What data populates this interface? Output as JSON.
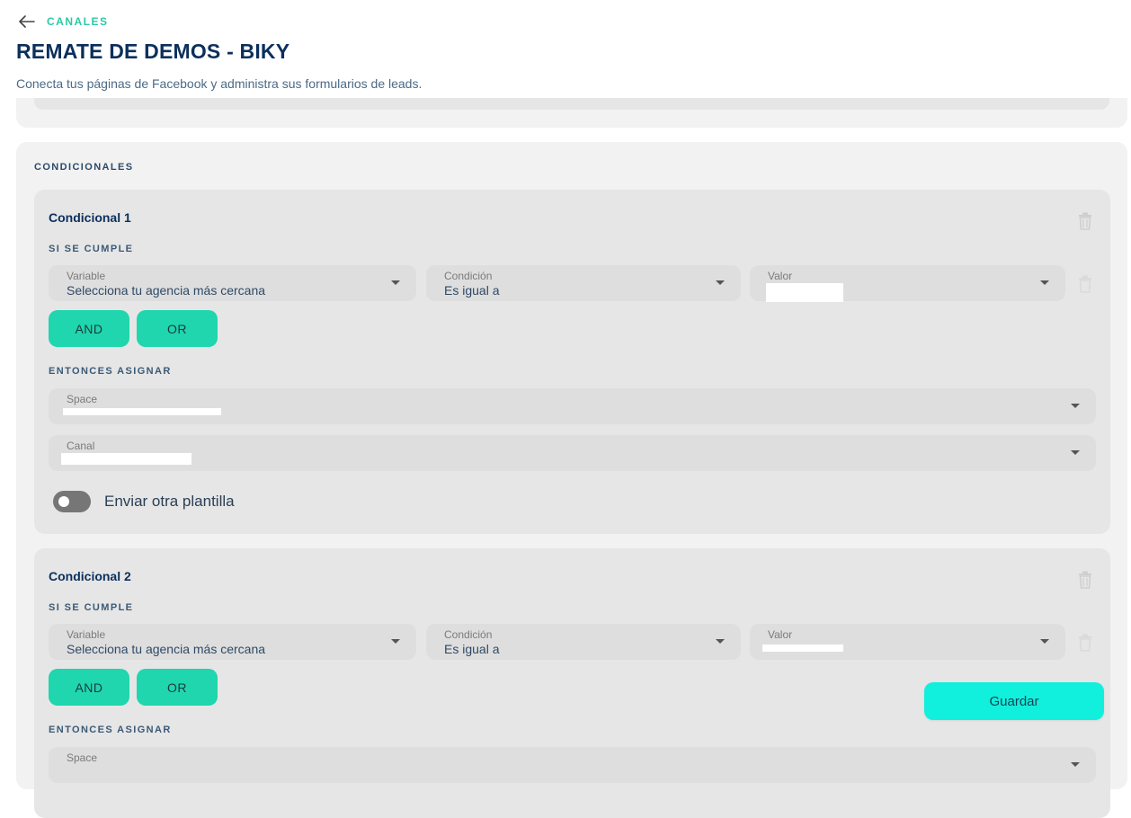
{
  "header": {
    "breadcrumb": "CANALES",
    "title": "REMATE DE DEMOS - BIKY",
    "subtitle": "Conecta tus páginas de Facebook y administra sus formularios de leads."
  },
  "conditionals": {
    "section_label": "CONDICIONALES",
    "items": [
      {
        "title": "Condicional 1",
        "if_label": "SI SE CUMPLE",
        "variable_label": "Variable",
        "variable_value": "Selecciona tu agencia más cercana",
        "condition_label": "Condición",
        "condition_value": "Es igual a",
        "value_label": "Valor",
        "and_label": "AND",
        "or_label": "OR",
        "then_label": "ENTONCES ASIGNAR",
        "space_label": "Space",
        "channel_label": "Canal",
        "toggle_label": "Enviar otra plantilla"
      },
      {
        "title": "Condicional 2",
        "if_label": "SI SE CUMPLE",
        "variable_label": "Variable",
        "variable_value": "Selecciona tu agencia más cercana",
        "condition_label": "Condición",
        "condition_value": "Es igual a",
        "value_label": "Valor",
        "and_label": "AND",
        "or_label": "OR",
        "then_label": "ENTONCES ASIGNAR",
        "space_label": "Space"
      }
    ]
  },
  "actions": {
    "save_label": "Guardar"
  },
  "icons": {
    "back": "arrow-left-icon",
    "delete": "trash-icon",
    "dropdown": "caret-down-icon"
  },
  "colors": {
    "accent": "#1fd6ae",
    "save": "#10f0dc",
    "title": "#0c2f5c",
    "breadcrumb": "#2cc9a6"
  }
}
